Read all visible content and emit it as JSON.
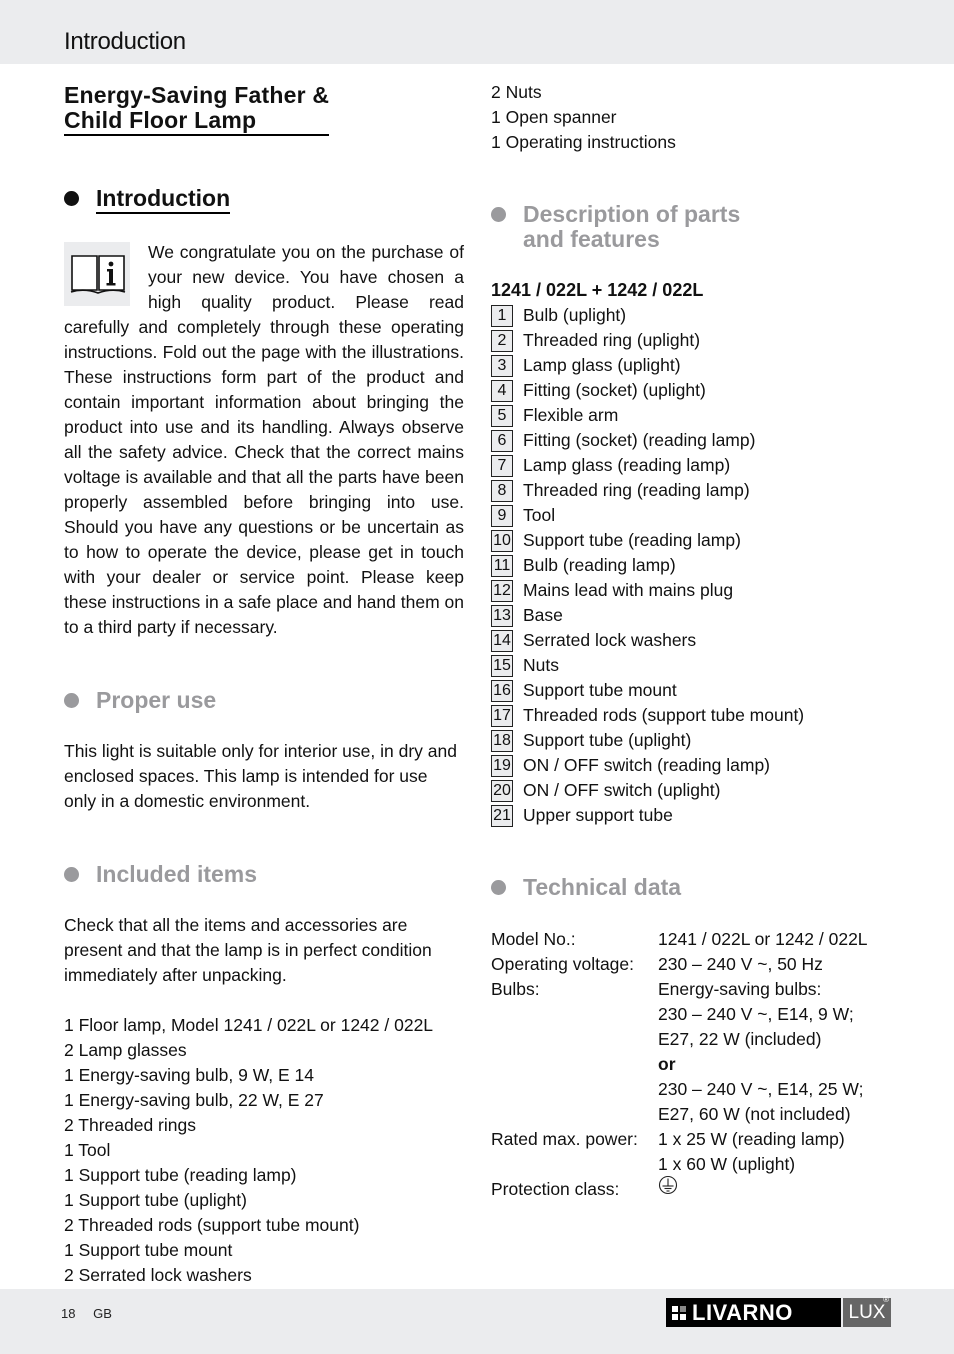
{
  "header": {
    "title": "Introduction"
  },
  "document": {
    "title_line1": "Energy-Saving Father &",
    "title_line2": "Child Floor Lamp"
  },
  "sections": {
    "introduction": {
      "heading": "Introduction",
      "icon": "info-book-icon",
      "paragraph": "We congratulate you on the purchase of your new device. You have chosen a high quality product. Please read carefully and completely through these operating instructions. Fold out the page with the illustrations. These instructions form part of the product and contain important information about bringing the product into use and its handling. Always observe all the safety advice. Check that the correct mains voltage is available and that all the parts have been properly assembled before bringing into use. Should you have any questions or be uncertain as to how to operate the device, please get in touch with your dealer or service point. Please keep these instructions in a safe place and hand them on to a third party if necessary."
    },
    "proper_use": {
      "heading": "Proper use",
      "paragraph": "This light is suitable only for interior use, in dry and enclosed spaces. This lamp is intended for use only in a domestic environment."
    },
    "included_items": {
      "heading": "Included items",
      "paragraph": "Check that all the items and accessories are present and that the lamp is in perfect condition immediately after unpacking.",
      "items": [
        "1 Floor lamp, Model 1241 / 022L or 1242 / 022L",
        "2 Lamp glasses",
        "1 Energy-saving bulb, 9 W, E 14",
        "1 Energy-saving bulb, 22 W, E 27",
        "2 Threaded rings",
        "1 Tool",
        "1 Support tube (reading lamp)",
        "1 Support tube (uplight)",
        "2 Threaded rods (support tube mount)",
        "1 Support tube mount",
        "2 Serrated lock washers",
        "2 Nuts",
        "1 Open spanner",
        "1 Operating instructions"
      ]
    },
    "parts": {
      "heading_line1": "Description of parts",
      "heading_line2": "and features",
      "model_header": "1241 / 022L + 1242 / 022L",
      "items": [
        {
          "num": "1",
          "label": "Bulb (uplight)"
        },
        {
          "num": "2",
          "label": "Threaded ring (uplight)"
        },
        {
          "num": "3",
          "label": "Lamp glass (uplight)"
        },
        {
          "num": "4",
          "label": "Fitting (socket) (uplight)"
        },
        {
          "num": "5",
          "label": "Flexible arm"
        },
        {
          "num": "6",
          "label": "Fitting (socket) (reading lamp)"
        },
        {
          "num": "7",
          "label": "Lamp glass (reading lamp)"
        },
        {
          "num": "8",
          "label": "Threaded ring (reading lamp)"
        },
        {
          "num": "9",
          "label": "Tool"
        },
        {
          "num": "10",
          "label": "Support tube (reading lamp)"
        },
        {
          "num": "11",
          "label": "Bulb (reading lamp)"
        },
        {
          "num": "12",
          "label": "Mains lead with mains plug"
        },
        {
          "num": "13",
          "label": "Base"
        },
        {
          "num": "14",
          "label": "Serrated lock washers"
        },
        {
          "num": "15",
          "label": "Nuts"
        },
        {
          "num": "16",
          "label": "Support tube mount"
        },
        {
          "num": "17",
          "label": "Threaded rods (support tube mount)"
        },
        {
          "num": "18",
          "label": "Support tube (uplight)"
        },
        {
          "num": "19",
          "label": "ON / OFF switch (reading lamp)"
        },
        {
          "num": "20",
          "label": "ON / OFF switch (uplight)"
        },
        {
          "num": "21",
          "label": "Upper support tube"
        }
      ]
    },
    "technical_data": {
      "heading": "Technical data",
      "model_label": "Model No.:",
      "model_value": "1241 / 022L or 1242 / 022L",
      "voltage_label": "Operating voltage:",
      "voltage_value": "230 – 240 V ~, 50 Hz",
      "bulbs_label": "Bulbs:",
      "bulbs_lines": [
        "Energy-saving bulbs:",
        "230 – 240 V ~, E14, 9 W;",
        "E27, 22 W (included)",
        "or",
        "230 – 240 V ~, E14, 25 W;",
        "E27, 60 W (not included)"
      ],
      "power_label": "Rated max. power:",
      "power_lines": [
        "1 x 25 W (reading lamp)",
        "1 x 60 W (uplight)"
      ],
      "protection_label": "Protection class:",
      "protection_icon": "protective-earth-icon"
    }
  },
  "footer": {
    "page_number": "18",
    "language": "GB",
    "brand": "LIVARNO",
    "brand_suffix": "LUX",
    "registered_mark": "®"
  },
  "colors": {
    "band_grey": "#ebecee",
    "heading_grey": "#9a9a9d",
    "text": "#111111",
    "logo_black": "#000000",
    "logo_lux_grey": "#666666"
  }
}
